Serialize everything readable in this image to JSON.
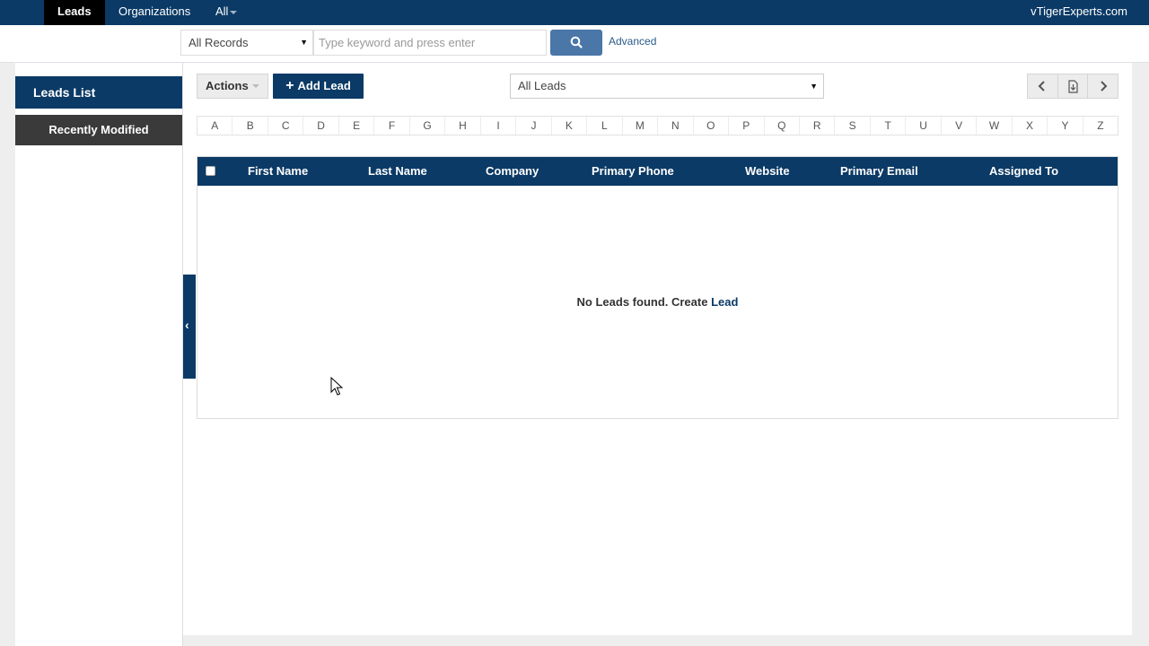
{
  "topnav": {
    "tabs": [
      {
        "label": "Leads",
        "active": true
      },
      {
        "label": "Organizations",
        "active": false
      },
      {
        "label": "All",
        "active": false
      }
    ],
    "brand": "vTigerExperts.com"
  },
  "search": {
    "records_select": "All Records",
    "placeholder": "Type keyword and press enter",
    "search_icon": "search-icon",
    "advanced_label": "Advanced"
  },
  "sidebar": {
    "title": "Leads List",
    "recent_label": "Recently Modified"
  },
  "toolbar": {
    "actions_label": "Actions",
    "add_label": "Add Lead",
    "view_select": "All Leads",
    "pager_icons": [
      "chevron-left-icon",
      "export-icon",
      "chevron-right-icon"
    ]
  },
  "alphabet": [
    "A",
    "B",
    "C",
    "D",
    "E",
    "F",
    "G",
    "H",
    "I",
    "J",
    "K",
    "L",
    "M",
    "N",
    "O",
    "P",
    "Q",
    "R",
    "S",
    "T",
    "U",
    "V",
    "W",
    "X",
    "Y",
    "Z"
  ],
  "table": {
    "columns": [
      "First Name",
      "Last Name",
      "Company",
      "Primary Phone",
      "Website",
      "Primary Email",
      "Assigned To"
    ],
    "empty_text": "No Leads found. Create",
    "empty_link": "Lead"
  },
  "colors": {
    "primary": "#0b3a66",
    "dark_button": "#3a3a3a",
    "search_button": "#4a76a8"
  }
}
